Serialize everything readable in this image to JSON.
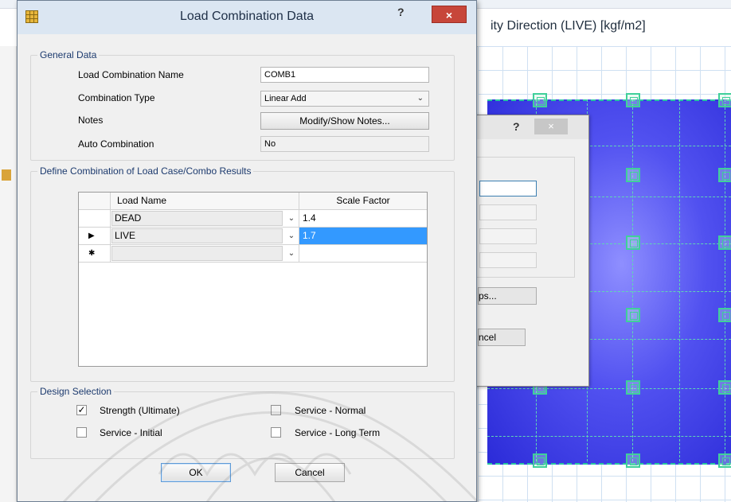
{
  "background": {
    "view_title": "ity Direction (LIVE)  [kgf/m2]"
  },
  "secondary_dialog": {
    "help_label": "?",
    "close_label": "×",
    "button_1_label": "ps...",
    "button_2_label": "ncel"
  },
  "dialog": {
    "title": "Load Combination Data",
    "help_label": "?",
    "close_label": "×",
    "general": {
      "group_title": "General Data",
      "name_label": "Load Combination Name",
      "name_value": "COMB1",
      "type_label": "Combination Type",
      "type_value": "Linear Add",
      "notes_label": "Notes",
      "notes_button": "Modify/Show Notes...",
      "auto_label": "Auto Combination",
      "auto_value": "No"
    },
    "define": {
      "group_title": "Define Combination of Load Case/Combo Results",
      "columns": [
        "Load Name",
        "Scale Factor"
      ],
      "rows": [
        {
          "marker": "",
          "load_name": "DEAD",
          "scale_factor": "1.4",
          "selected": false
        },
        {
          "marker": "▶",
          "load_name": "LIVE",
          "scale_factor": "1.7",
          "selected": true
        },
        {
          "marker": "✱",
          "load_name": "",
          "scale_factor": "",
          "selected": false
        }
      ]
    },
    "design": {
      "group_title": "Design Selection",
      "options": [
        {
          "label": "Strength (Ultimate)",
          "checked": true
        },
        {
          "label": "Service - Normal",
          "checked": false
        },
        {
          "label": "Service - Initial",
          "checked": false
        },
        {
          "label": "Service - Long Term",
          "checked": false
        }
      ]
    },
    "ok_label": "OK",
    "cancel_label": "Cancel"
  },
  "colors": {
    "title_bar": "#dbe6f2",
    "close_button": "#c7463a",
    "selection": "#3399ff",
    "group_title": "#1c3a6e",
    "slab": "#4545e8"
  }
}
